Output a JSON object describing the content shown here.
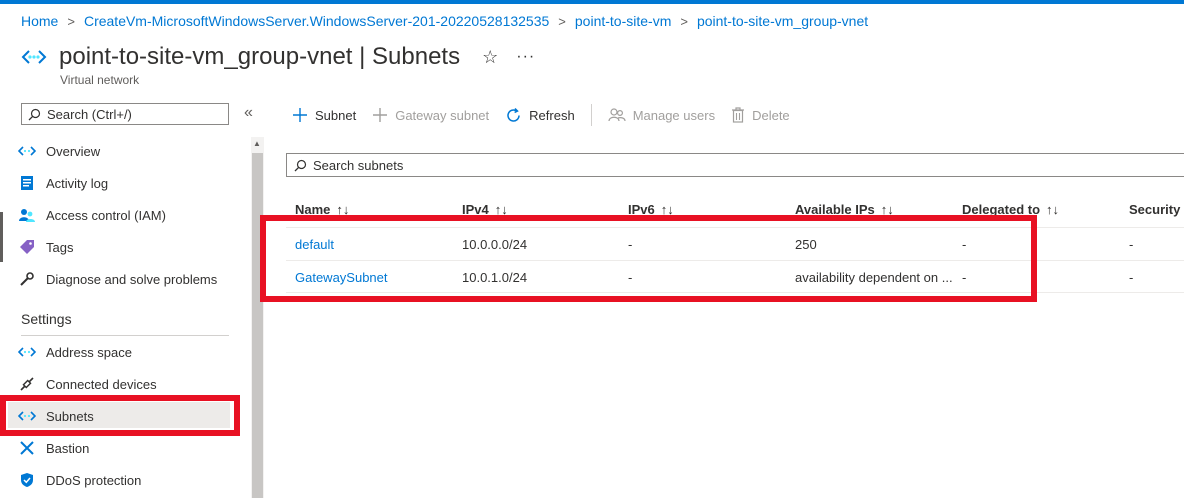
{
  "breadcrumb": [
    "Home",
    "CreateVm-MicrosoftWindowsServer.WindowsServer-201-20220528132535",
    "point-to-site-vm",
    "point-to-site-vm_group-vnet"
  ],
  "title": "point-to-site-vm_group-vnet | Subnets",
  "subtitle": "Virtual network",
  "left_search_placeholder": "Search (Ctrl+/)",
  "nav": {
    "overview": "Overview",
    "activity_log": "Activity log",
    "access_control": "Access control (IAM)",
    "tags": "Tags",
    "diagnose": "Diagnose and solve problems",
    "settings_header": "Settings",
    "address_space": "Address space",
    "connected_devices": "Connected devices",
    "subnets": "Subnets",
    "bastion": "Bastion",
    "ddos": "DDoS protection"
  },
  "toolbar": {
    "subnet": "Subnet",
    "gateway_subnet": "Gateway subnet",
    "refresh": "Refresh",
    "manage_users": "Manage users",
    "delete": "Delete"
  },
  "search_subnets_placeholder": "Search subnets",
  "table": {
    "headers": [
      "Name",
      "IPv4",
      "IPv6",
      "Available IPs",
      "Delegated to",
      "Security g"
    ],
    "rows": [
      [
        "default",
        "10.0.0.0/24",
        "-",
        "250",
        "-",
        "-"
      ],
      [
        "GatewaySubnet",
        "10.0.1.0/24",
        "-",
        "availability dependent on ...",
        "-",
        "-"
      ]
    ]
  },
  "colors": {
    "accent": "#0078d4",
    "highlight": "#e81123"
  }
}
